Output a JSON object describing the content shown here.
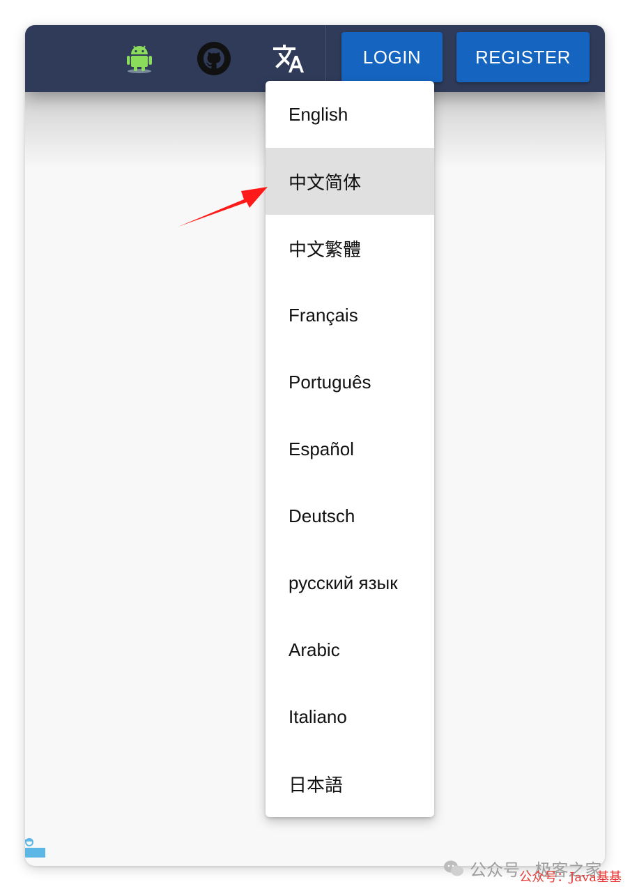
{
  "appbar": {
    "icons": [
      "android-icon",
      "github-icon",
      "translate-icon"
    ],
    "login_label": "LOGIN",
    "register_label": "REGISTER"
  },
  "language_menu": {
    "items": [
      {
        "label": "English",
        "selected": false
      },
      {
        "label": "中文简体",
        "selected": true
      },
      {
        "label": "中文繁體",
        "selected": false
      },
      {
        "label": "Français",
        "selected": false
      },
      {
        "label": "Português",
        "selected": false
      },
      {
        "label": "Español",
        "selected": false
      },
      {
        "label": "Deutsch",
        "selected": false
      },
      {
        "label": "русский язык",
        "selected": false
      },
      {
        "label": "Arabic",
        "selected": false
      },
      {
        "label": "Italiano",
        "selected": false
      },
      {
        "label": "日本語",
        "selected": false
      }
    ]
  },
  "watermarks": {
    "wechat_text": "公众号 · 极客之家",
    "red_text": "公众号：Java基基"
  },
  "colors": {
    "appbar": "#2f3b59",
    "button": "#1565c0",
    "selected_item": "#e0e0e0",
    "arrow": "#ff1a1a",
    "watermark": "#e53935"
  }
}
